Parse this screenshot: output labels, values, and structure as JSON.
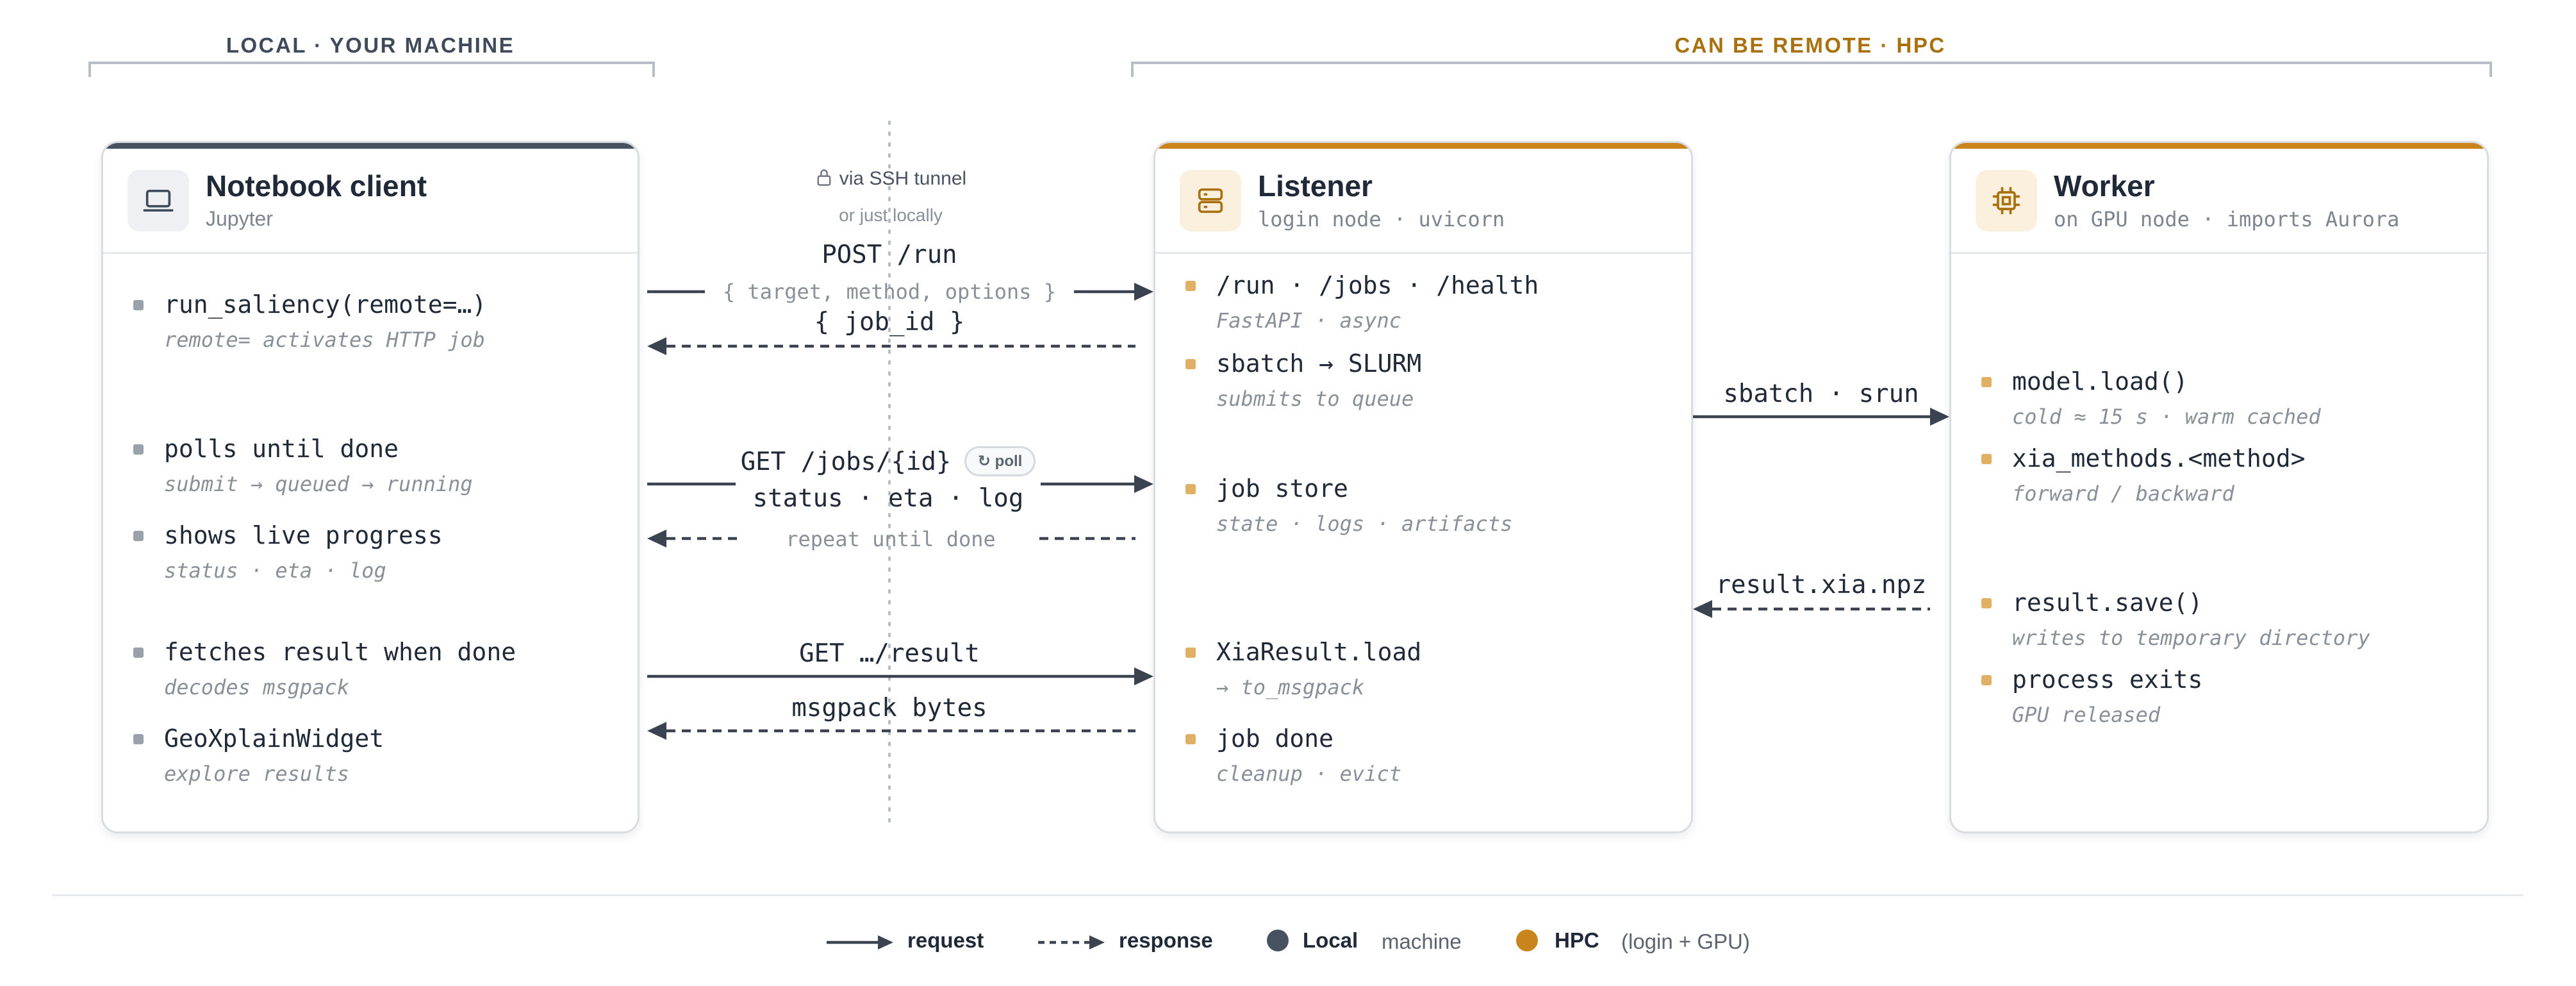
{
  "groups": {
    "local": "LOCAL · YOUR MACHINE",
    "hpc": "CAN BE REMOTE · HPC"
  },
  "colors": {
    "local": "#475160",
    "hpc": "#c9841b",
    "arrow": "#3b4350",
    "item_local": "#9aa1aa",
    "item_hpc": "#e0b064"
  },
  "notebook": {
    "title": "Notebook client",
    "subtitle": "Jupyter",
    "icon": "laptop-icon",
    "items": [
      {
        "label": "run_saliency(remote=…)",
        "sub": "remote= activates HTTP job"
      },
      {
        "label": "polls until done",
        "sub": "submit → queued → running"
      },
      {
        "label": "shows live progress",
        "sub": "status · eta · log"
      },
      {
        "label": "fetches result when done",
        "sub": "decodes msgpack"
      },
      {
        "label": "GeoXplainWidget",
        "sub": "explore results"
      }
    ]
  },
  "listener": {
    "title": "Listener",
    "subtitle": "login node · uvicorn",
    "icon": "server-icon",
    "items": [
      {
        "label": "/run · /jobs · /health",
        "sub": "FastAPI · async"
      },
      {
        "label": "sbatch → SLURM",
        "sub": "submits to queue"
      },
      {
        "label": "job store",
        "sub": "state · logs · artifacts"
      },
      {
        "label": "XiaResult.load",
        "sub": "→ to_msgpack"
      },
      {
        "label": "job done",
        "sub": "cleanup · evict"
      }
    ]
  },
  "worker": {
    "title": "Worker",
    "subtitle": "on GPU node · imports Aurora",
    "icon": "cpu-chip-icon",
    "items": [
      {
        "label": "model.load()",
        "sub": "cold ≈ 15 s · warm cached"
      },
      {
        "label": "xia_methods.<method>",
        "sub": "forward / backward"
      },
      {
        "label": "result.save()",
        "sub": "writes to temporary directory"
      },
      {
        "label": "process exits",
        "sub": "GPU released"
      }
    ]
  },
  "channel": {
    "tunnel": "via SSH tunnel",
    "tunnel_alt": "or just locally",
    "post_run": "POST /run",
    "post_payload": "{ target, method, options }",
    "post_response": "{ job_id }",
    "get_jobs": "GET /jobs/{id}",
    "poll_badge": "↻ poll",
    "status_response": "status · eta · log",
    "repeat": "repeat until done",
    "get_result": "GET …/result",
    "result_response": "msgpack bytes"
  },
  "hpc_channel": {
    "sbatch": "sbatch · srun",
    "result_file": "result.xia.npz"
  },
  "legend": {
    "request": "request",
    "response": "response",
    "local": "Local",
    "local_desc": "machine",
    "hpc": "HPC",
    "hpc_desc": "(login + GPU)"
  }
}
